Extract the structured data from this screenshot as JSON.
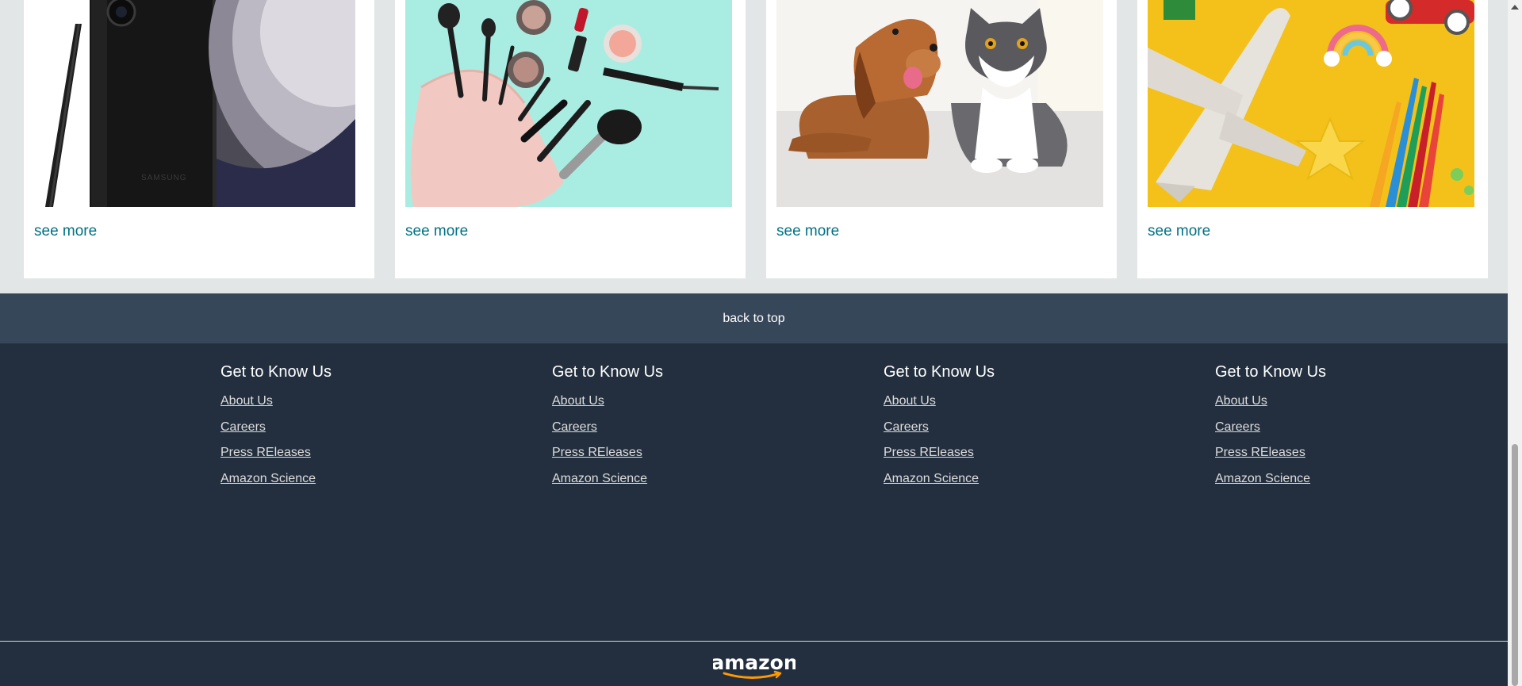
{
  "cards": [
    {
      "image_alt": "Samsung smartphone with stylus",
      "link": "see more"
    },
    {
      "image_alt": "Makeup brushes and cosmetics bag",
      "link": "see more"
    },
    {
      "image_alt": "Dog and cat lying on floor",
      "link": "see more"
    },
    {
      "image_alt": "Toys and colored pencils",
      "link": "see more"
    }
  ],
  "phone_brand": "SAMSUNG",
  "back_to_top": "back to top",
  "footer": {
    "columns": [
      {
        "heading": "Get to Know Us",
        "links": [
          "About Us",
          "Careers",
          "Press REleases",
          "Amazon Science"
        ]
      },
      {
        "heading": "Get to Know Us",
        "links": [
          "About Us",
          "Careers",
          "Press REleases",
          "Amazon Science"
        ]
      },
      {
        "heading": "Get to Know Us",
        "links": [
          "About Us",
          "Careers",
          "Press REleases",
          "Amazon Science"
        ]
      },
      {
        "heading": "Get to Know Us",
        "links": [
          "About Us",
          "Careers",
          "Press REleases",
          "Amazon Science"
        ]
      }
    ],
    "logo_text": "amazon"
  },
  "colors": {
    "link": "#007185",
    "back_to_top_bg": "#37475a",
    "footer_bg": "#232f3e",
    "logo_smile": "#ff9900"
  }
}
